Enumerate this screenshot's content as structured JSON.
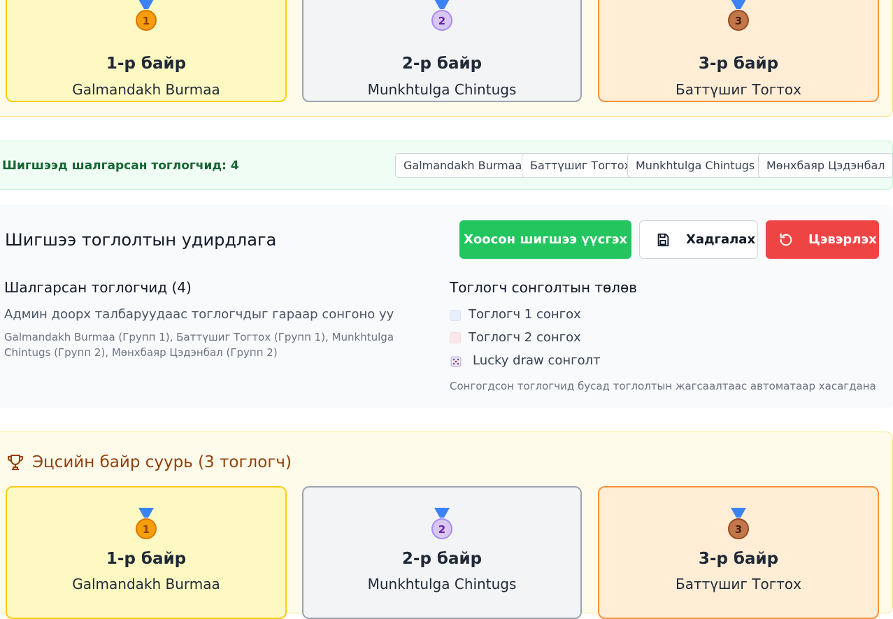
{
  "top_podium": {
    "places": [
      {
        "label": "1-р байр",
        "name": "Galmandakh Burmaa",
        "medal": "gold-medal-icon",
        "number": "1"
      },
      {
        "label": "2-р байр",
        "name": "Munkhtulga Chintugs",
        "medal": "silver-medal-icon",
        "number": "2"
      },
      {
        "label": "3-р байр",
        "name": "Баттүшиг Тогтох",
        "medal": "bronze-medal-icon",
        "number": "3"
      }
    ]
  },
  "selected": {
    "label": "Шигшээд шалгарсан тоглогчид: 4",
    "players": [
      "Galmandakh Burmaa",
      "Баттүшиг Тогтох",
      "Munkhtulga Chintugs",
      "Мөнхбаяр Цэдэнбал"
    ]
  },
  "control": {
    "title": "Шигшээ тоглолтын удирдлага",
    "create_button": "Хоосон шигшээ үүсгэх",
    "save_button": "Хадгалах",
    "reset_button": "Цэвэрлэх",
    "qualified_heading": "Шалгарсан тоглогчид (4)",
    "hint": "Админ доорх талбаруудаас тоглогчдыг гараар сонгоно уу",
    "qualified_list": "Galmandakh Burmaa (Групп 1), Баттүшиг Тогтох (Групп 1), Munkhtulga Chintugs (Групп 2), Мөнхбаяр Цэдэнбал (Групп 2)",
    "selection_heading": "Тоглогч сонголтын төлөв",
    "option1": "Тоглогч 1 сонгох",
    "option2": "Тоглогч 2 сонгох",
    "option3": "Lucky draw сонголт",
    "note": "Сонгогдсон тоглогчид бусад тоглолтын жагсаалтаас автоматаар хасагдана"
  },
  "bottom_podium": {
    "title": "Эцсийн байр суурь (3 тоглогч)",
    "places": [
      {
        "label": "1-р байр",
        "name": "Galmandakh Burmaa",
        "number": "1"
      },
      {
        "label": "2-р байр",
        "name": "Munkhtulga Chintugs",
        "number": "2"
      },
      {
        "label": "3-р байр",
        "name": "Баттүшиг Тогтох",
        "number": "3"
      }
    ]
  },
  "colors": {
    "green": "#22c55e",
    "red": "#ef4444",
    "gold_bg": "#fef9c3",
    "silver_bg": "#f3f4f6",
    "bronze_bg": "#ffedd5"
  }
}
